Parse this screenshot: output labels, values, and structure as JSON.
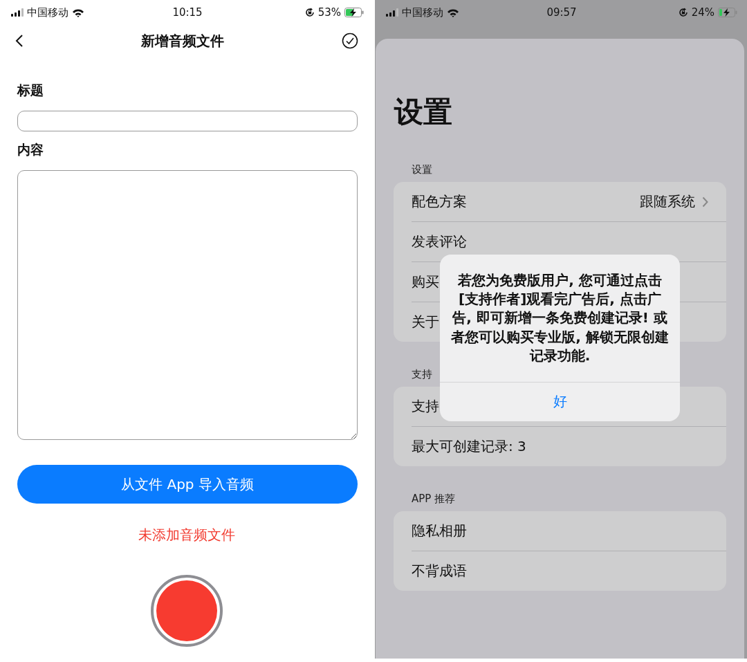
{
  "left": {
    "status_bar": {
      "carrier": "中国移动",
      "time": "10:15",
      "battery": "53%"
    },
    "nav": {
      "title": "新增音频文件"
    },
    "fields": [
      {
        "label": "标题",
        "kind": "line"
      },
      {
        "label": "内容",
        "kind": "area"
      }
    ],
    "import_button": "从文件 App 导入音频",
    "status_text": "未添加音频文件"
  },
  "right": {
    "status_bar": {
      "carrier": "中国移动",
      "time": "09:57",
      "battery": "24%"
    },
    "sheet": {
      "title": "设置",
      "sections": [
        {
          "header": "设置",
          "rows": [
            {
              "label": "配色方案",
              "value": "跟随系统"
            },
            {
              "label": "发表评论"
            },
            {
              "label": "购买"
            },
            {
              "label": "关于"
            }
          ]
        },
        {
          "header": "支持",
          "rows": [
            {
              "label": "支持"
            },
            {
              "label": "最大可创建记录: 3"
            }
          ]
        },
        {
          "header": "APP 推荐",
          "rows": [
            {
              "label": "隐私相册"
            },
            {
              "label": "不背成语"
            }
          ]
        }
      ]
    },
    "alert": {
      "message": "若您为免费版用户, 您可通过点击[支持作者]观看完广告后, 点击广告, 即可新增一条免费创建记录! 或者您可以购买专业版, 解锁无限创建记录功能.",
      "button": "好"
    }
  }
}
